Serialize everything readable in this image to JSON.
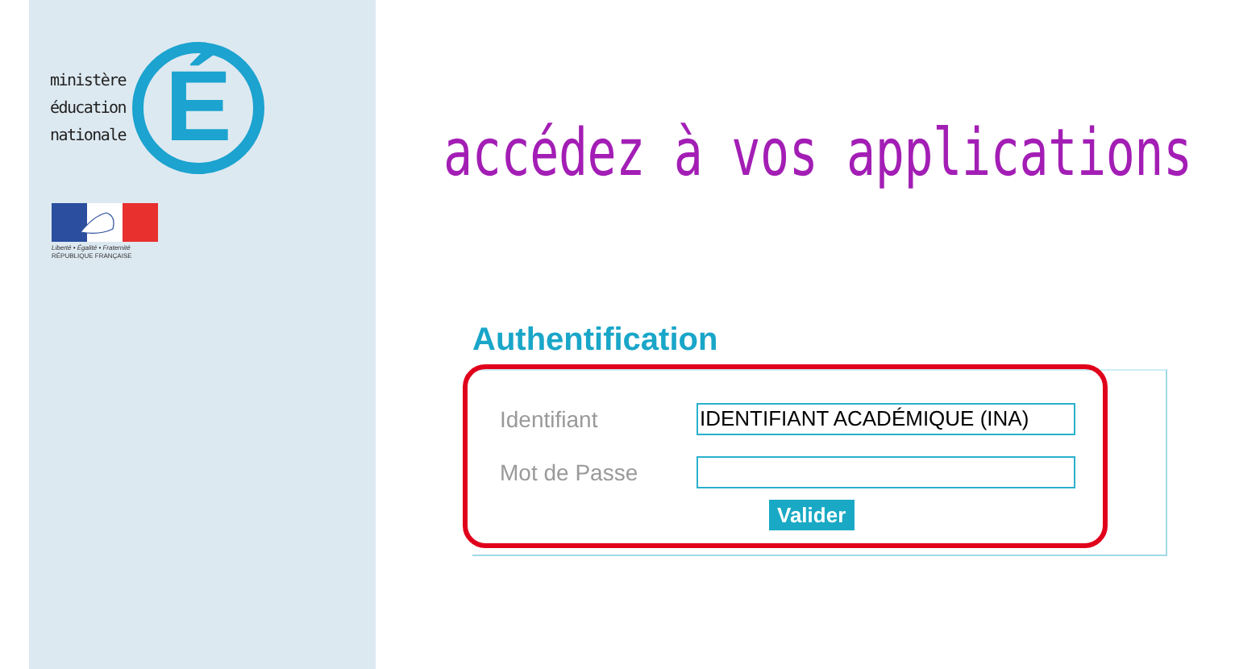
{
  "logo": {
    "lines": [
      "ministère",
      "éducation",
      "nationale"
    ],
    "mark": "É"
  },
  "republic": {
    "motto": "Liberté • Égalité • Fraternité",
    "name": "RÉPUBLIQUE FRANÇAISE"
  },
  "headline": "accédez à vos applications",
  "login": {
    "title": "Authentification",
    "fields": [
      {
        "label": "Identifiant",
        "value": "IDENTIFIANT ACADÉMIQUE (INA)"
      },
      {
        "label": "Mot de Passe"
      }
    ],
    "submit": "Valider"
  }
}
